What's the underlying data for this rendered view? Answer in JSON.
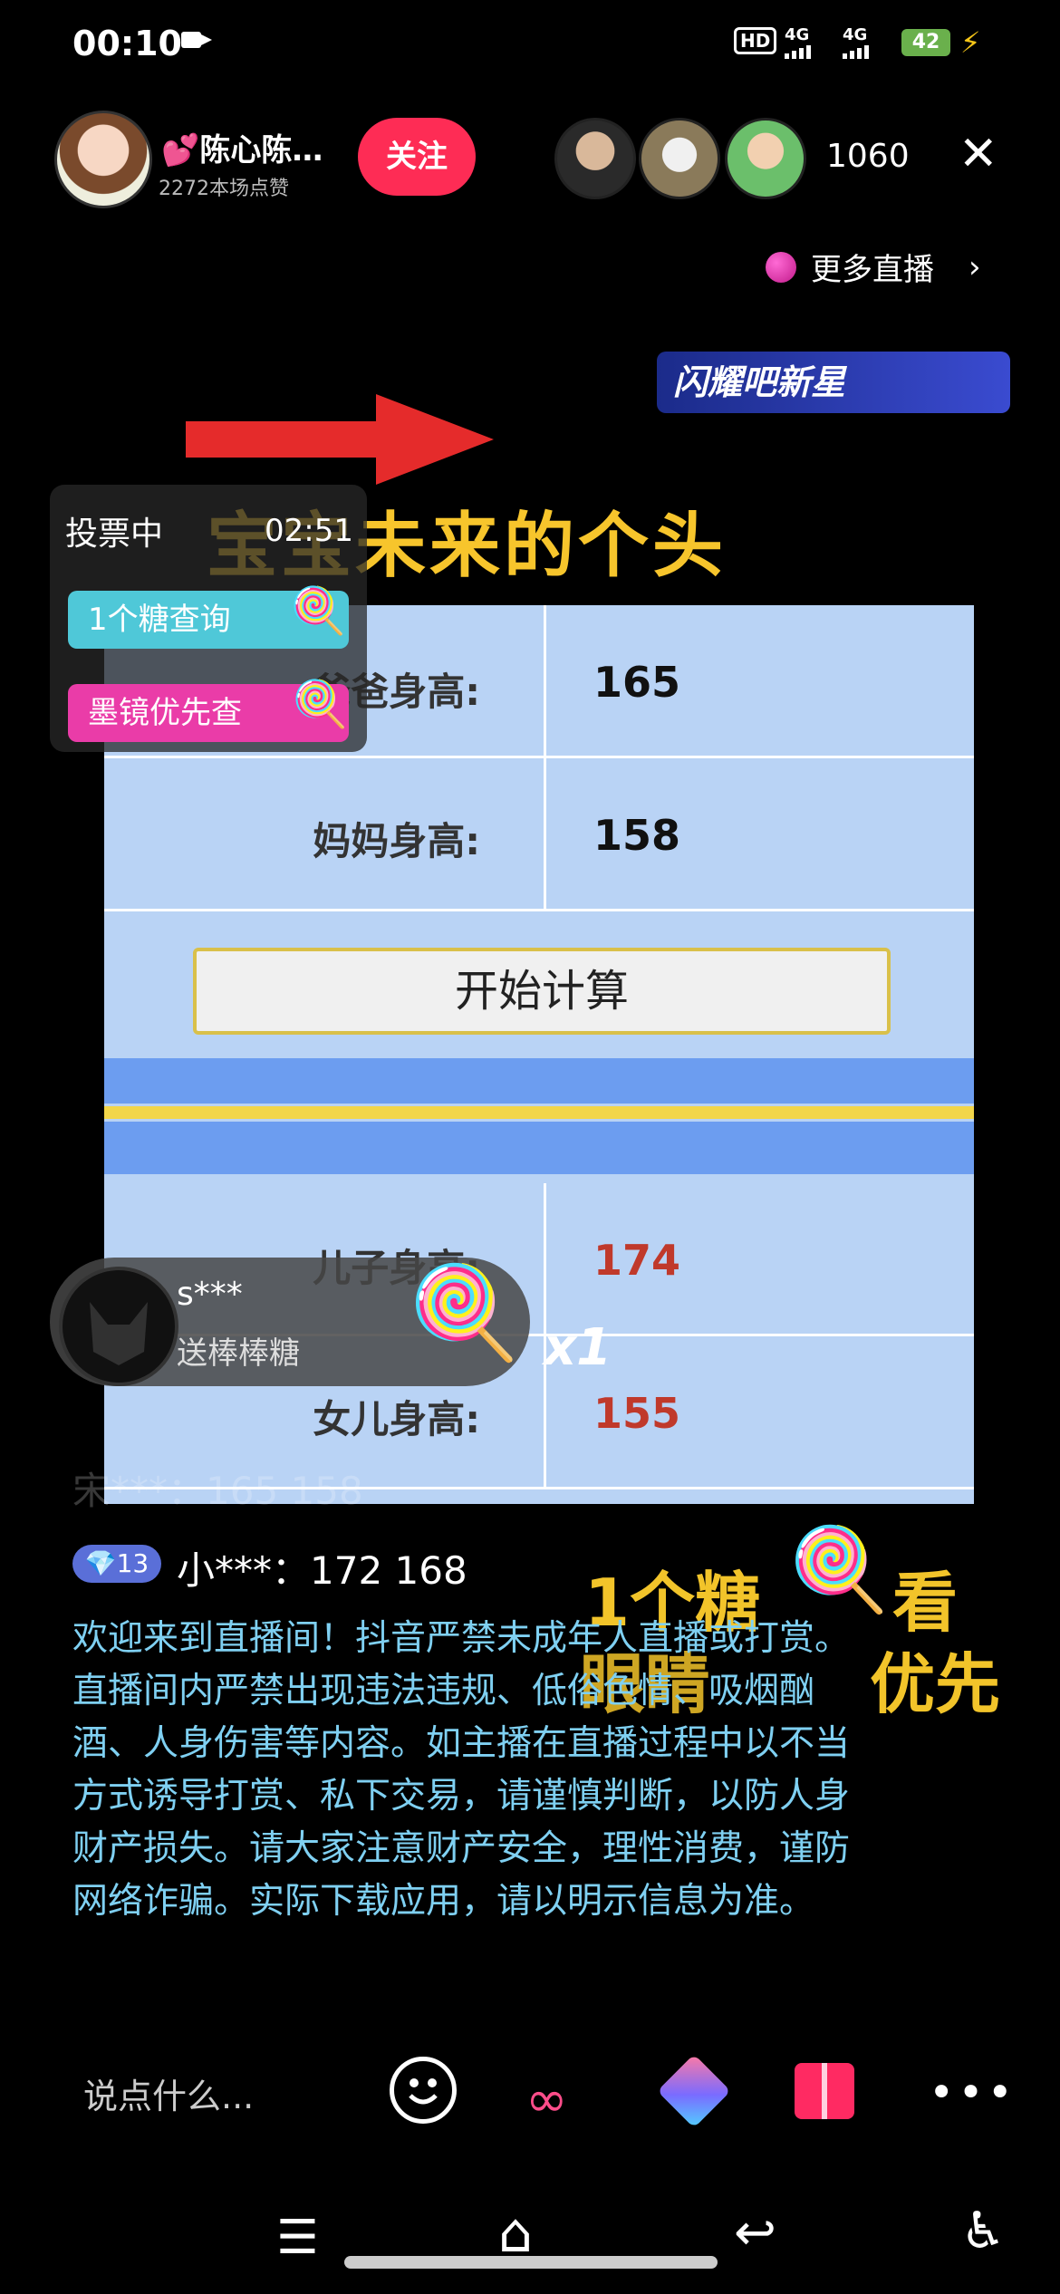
{
  "status_bar": {
    "time": "00:10",
    "hd_label": "HD",
    "signal1": "4G",
    "signal2": "4G",
    "battery": "42"
  },
  "header": {
    "host_name": "💕陈心陈…",
    "likes": "2272本场点赞",
    "follow_label": "关注",
    "viewer_count": "1060",
    "close_symbol": "✕"
  },
  "more_live": {
    "label": "更多直播",
    "chevron": "›"
  },
  "star_banner": "闪耀吧新星",
  "vote": {
    "title": "投票中",
    "timer": "02:51",
    "btn1": "1个糖查询",
    "btn2": "墨镜优先查"
  },
  "overlay_title": "宝宝未来的个头",
  "calculator": {
    "dad_label": "爸爸身高:",
    "dad_value": "165",
    "mom_label": "妈妈身高:",
    "mom_value": "158",
    "button": "开始计算",
    "son_label": "儿子身高:",
    "son_value": "174",
    "daughter_label": "女儿身高:",
    "daughter_value": "155"
  },
  "gift": {
    "user": "s***",
    "action": "送棒棒糖",
    "count": "x1"
  },
  "ghost_comment": "宋***：165 158",
  "comment": {
    "level": "13",
    "text": "小***：172  168"
  },
  "promo": {
    "line1a": "1个糖",
    "line1b": "看",
    "line2a": "眼睛",
    "line2b": "优先"
  },
  "notice": "欢迎来到直播间！抖音严禁未成年人直播或打赏。直播间内严禁出现违法违规、低俗色情、吸烟酗酒、人身伤害等内容。如主播在直播过程中以不当方式诱导打赏、私下交易，请谨慎判断，以防人身财产损失。请大家注意财产安全，理性消费，谨防网络诈骗。实际下载应用，请以明示信息为准。",
  "bottom_bar": {
    "placeholder": "说点什么..."
  },
  "colors": {
    "follow": "#fe2c55",
    "title_yellow": "#f7c52c",
    "notice_blue": "#7fd0f2",
    "card_blue": "#b9d3f5"
  }
}
